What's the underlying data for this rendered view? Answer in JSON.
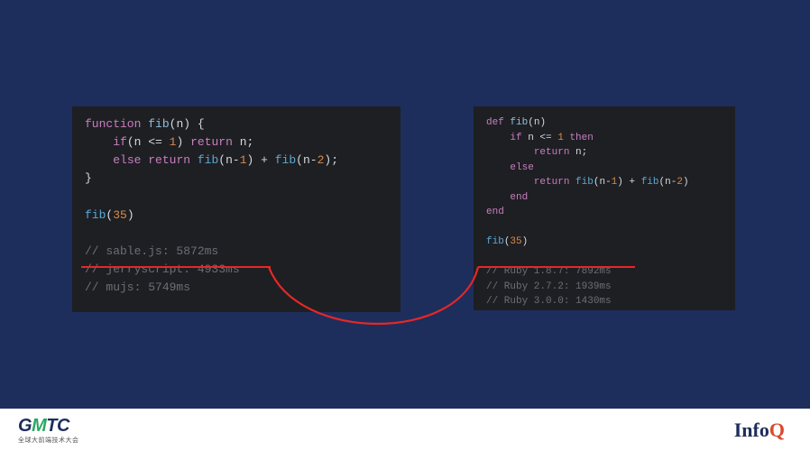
{
  "left_code": {
    "l1": {
      "kw1": "function",
      "fn": "fib",
      "p1": "(",
      "arg": "n",
      "p2": ") {"
    },
    "l2": {
      "indent": "    ",
      "kw": "if",
      "p1": "(",
      "v": "n",
      "op": " <= ",
      "num": "1",
      "p2": ") ",
      "kw2": "return",
      "sp": " ",
      "v2": "n",
      "p3": ";"
    },
    "l3": {
      "indent": "    ",
      "kw": "else",
      "sp": " ",
      "kw2": "return",
      "sp2": " ",
      "fn": "fib",
      "p1": "(",
      "v": "n",
      "m": "-",
      "n1": "1",
      "p2": ") + ",
      "fn2": "fib",
      "p3": "(",
      "v2": "n",
      "m2": "-",
      "n2": "2",
      "p4": ");"
    },
    "l4": {
      "brace": "}"
    },
    "l5": "",
    "l6": {
      "fn": "fib",
      "p1": "(",
      "num": "35",
      "p2": ")"
    },
    "l7": "",
    "c1": "// sable.js: 5872ms",
    "c2": "// jerryscript: 4933ms",
    "c3": "// mujs: 5749ms"
  },
  "right_code": {
    "l1": {
      "kw": "def",
      "sp": " ",
      "fn": "fib",
      "p1": "(",
      "arg": "n",
      "p2": ")"
    },
    "l2": {
      "indent": "    ",
      "kw": "if",
      "sp": " ",
      "v": "n",
      "op": " <= ",
      "num": "1",
      "sp2": " ",
      "kw2": "then"
    },
    "l3": {
      "indent": "        ",
      "kw": "return",
      "sp": " ",
      "v": "n",
      "p": ";"
    },
    "l4": {
      "indent": "    ",
      "kw": "else"
    },
    "l5": {
      "indent": "        ",
      "kw": "return",
      "sp": " ",
      "fn": "fib",
      "p1": "(",
      "v": "n",
      "m": "-",
      "n1": "1",
      "p2": ") + ",
      "fn2": "fib",
      "p3": "(",
      "v2": "n",
      "m2": "-",
      "n2": "2",
      "p4": ")"
    },
    "l6": {
      "indent": "    ",
      "kw": "end"
    },
    "l7": {
      "kw": "end"
    },
    "l8": "",
    "l9": {
      "fn": "fib",
      "p1": "(",
      "num": "35",
      "p2": ")"
    },
    "l10": "",
    "c1": "// Ruby 1.8.7: 7892ms",
    "c2": "// Ruby 2.7.2: 1939ms",
    "c3": "// Ruby 3.0.0: 1430ms"
  },
  "footer": {
    "gmtc_pre": "G",
    "gmtc_accent": "M",
    "gmtc_post": "TC",
    "gmtc_sub": "全球大前端技术大会",
    "infoq_pre": "Info",
    "infoq_q": "Q"
  }
}
